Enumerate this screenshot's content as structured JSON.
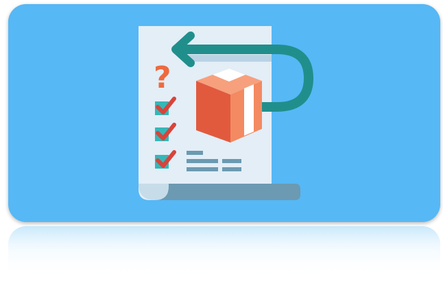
{
  "illustration": {
    "question_mark": "?",
    "checklist_items": 3,
    "colors": {
      "background": "#56b8f5",
      "paper": "#e3eef7",
      "paper_fold": "#b9d3e4",
      "paper_shadow": "#6b9ab2",
      "arrow": "#208f8c",
      "question": "#ee6a3f",
      "checkbox": "#33b8b9",
      "checkmark": "#d8443a",
      "box_front": "#e15a3e",
      "box_side": "#f38a61",
      "box_tape": "#ffffff",
      "lines": "#6b9ab2"
    }
  }
}
